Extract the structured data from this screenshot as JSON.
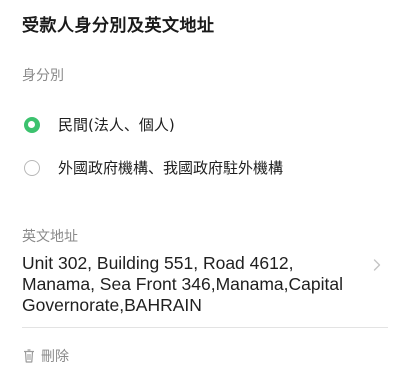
{
  "section": {
    "title": "受款人身分別及英文地址"
  },
  "identity": {
    "label": "身分別",
    "options": [
      {
        "label": "民間(法人、個人)",
        "selected": true
      },
      {
        "label": "外國政府機構、我國政府駐外機構",
        "selected": false
      }
    ]
  },
  "english_address": {
    "label": "英文地址",
    "value": "Unit 302, Building 551, Road 4612,\nManama, Sea Front 346,Manama,Capital\nGovernorate,BAHRAIN",
    "chevron_icon": "chevron-right-icon"
  },
  "delete": {
    "label": "刪除",
    "icon": "trash-icon"
  },
  "colors": {
    "accent": "#3cc26e",
    "muted_text": "#8a8a8a",
    "divider": "#e3e3e3"
  }
}
